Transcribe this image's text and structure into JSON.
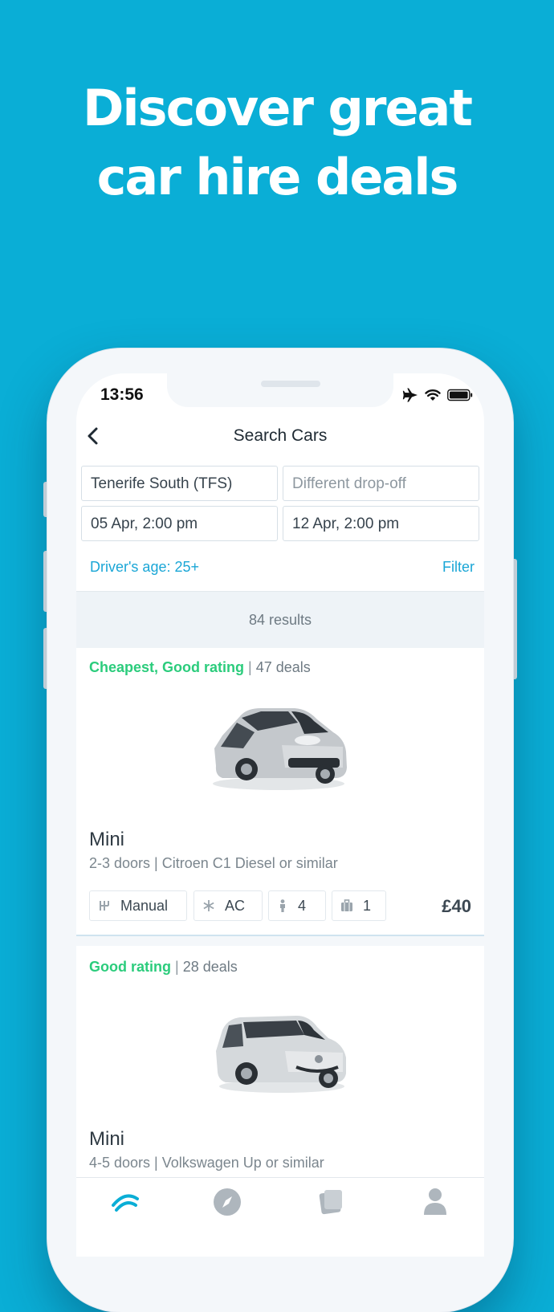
{
  "headline": {
    "line1": "Discover great",
    "line2": "car hire deals"
  },
  "status_bar": {
    "time": "13:56"
  },
  "nav": {
    "title": "Search Cars"
  },
  "search": {
    "pickup": "Tenerife South (TFS)",
    "dropoff_placeholder": "Different drop-off",
    "pickup_date": "05 Apr, 2:00 pm",
    "dropoff_date": "12 Apr, 2:00 pm",
    "drivers_age": "Driver's age: 25+",
    "filter": "Filter"
  },
  "results": {
    "count_label": "84 results"
  },
  "deals": [
    {
      "badge": "Cheapest, Good rating",
      "deal_count": "47 deals",
      "title": "Mini",
      "subtitle": "2-3 doors | Citroen C1 Diesel or similar",
      "features": {
        "transmission": "Manual",
        "ac": "AC",
        "seats": "4",
        "bags": "1"
      },
      "price": "£40"
    },
    {
      "badge": "Good rating",
      "deal_count": "28 deals",
      "title": "Mini",
      "subtitle": "4-5 doors | Volkswagen Up or similar"
    }
  ],
  "colors": {
    "background": "#0aaed6",
    "accent": "#1aa6d6",
    "rating_green": "#2bcc7c"
  },
  "icons": [
    "chevron-left-icon",
    "airplane-icon",
    "wifi-icon",
    "battery-icon",
    "transmission-icon",
    "snowflake-icon",
    "person-icon",
    "luggage-icon",
    "skyscanner-logo-icon",
    "compass-icon",
    "trips-icon",
    "profile-icon"
  ]
}
